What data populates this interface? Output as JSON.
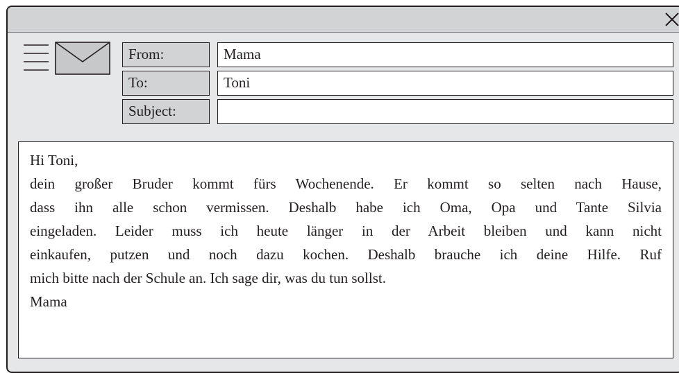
{
  "window": {
    "close_icon": "close-icon",
    "menu_icon": "hamburger-menu-icon",
    "mail_icon": "envelope-icon"
  },
  "header": {
    "from_label": "From:",
    "from_value": "Mama",
    "to_label": "To:",
    "to_value": "Toni",
    "subject_label": "Subject:",
    "subject_value": ""
  },
  "message": {
    "greeting": "Hi Toni,",
    "paragraph_lines": [
      "dein großer Bruder kommt fürs Wochenende. Er kommt so selten nach Hause,",
      "dass ihn alle schon vermissen. Deshalb habe ich Oma, Opa und Tante Silvia",
      "eingeladen. Leider muss ich heute länger in der Arbeit bleiben und kann nicht",
      "einkaufen, putzen und noch dazu kochen. Deshalb brauche ich deine Hilfe. Ruf",
      "mich bitte nach der Schule an. Ich sage dir, was du tun sollst."
    ],
    "signature": "Mama"
  },
  "colors": {
    "window_bg": "#e6e7e8",
    "titlebar_bg": "#d1d3d4",
    "label_bg": "#d1d3d4",
    "field_bg": "#ffffff",
    "ink": "#231f20"
  }
}
